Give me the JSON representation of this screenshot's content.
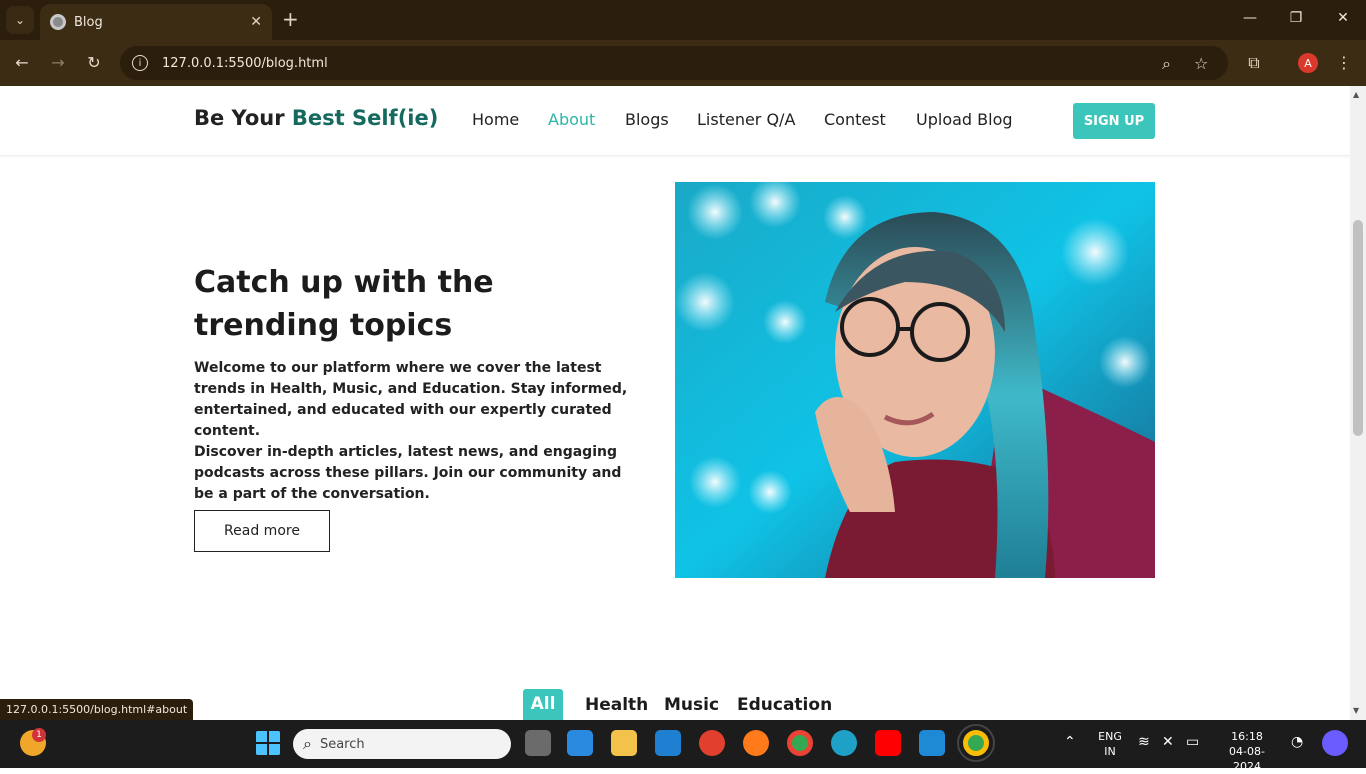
{
  "browser": {
    "tab_title": "Blog",
    "url": "127.0.0.1:5500/blog.html",
    "profile_initial": "A",
    "status_url": "127.0.0.1:5500/blog.html#about"
  },
  "site": {
    "brand_plain": "Be Your ",
    "brand_accent": "Best Self(ie)",
    "nav": [
      "Home",
      "About",
      "Blogs",
      "Listener Q/A",
      "Contest",
      "Upload Blog"
    ],
    "active_nav": "About",
    "signup_label": "SIGN UP"
  },
  "hero": {
    "title": "Catch up with the trending topics",
    "paragraph_1": "Welcome to our platform where we cover the latest trends in Health, Music, and Education. Stay informed, entertained, and educated with our expertly curated content.",
    "paragraph_2": "Discover in-depth articles, latest news, and engaging podcasts across these pillars. Join our community and be a part of the conversation.",
    "read_more_label": "Read more"
  },
  "filters": [
    "All",
    "Health",
    "Music",
    "Education"
  ],
  "active_filter": "All",
  "taskbar": {
    "search_placeholder": "Search",
    "notification_count": "1",
    "lang_line1": "ENG",
    "lang_line2": "IN",
    "time": "16:18",
    "date": "04-08-2024"
  },
  "colors": {
    "accent_teal": "#3cc6bb",
    "brand_green": "#16695f",
    "chrome_brown": "#3b2c13"
  }
}
